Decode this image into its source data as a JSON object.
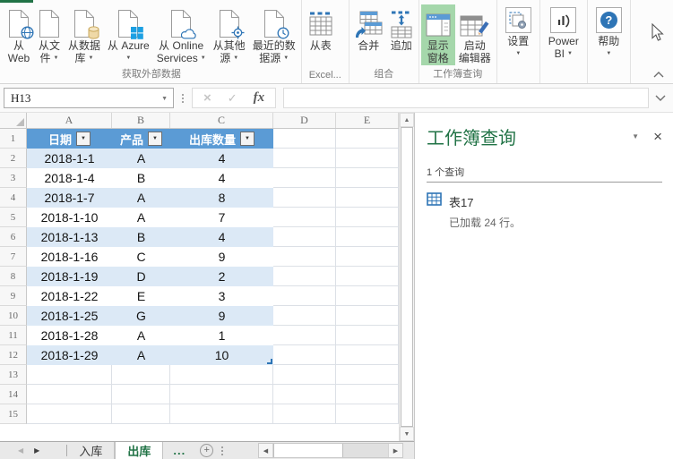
{
  "colors": {
    "excel_green": "#217346",
    "table_header_blue": "#5B9BD5",
    "banded_row_blue": "#DCE9F6",
    "active_button_green": "#A5D7AB"
  },
  "icons": {
    "dropdown_arrow": "▼",
    "filter_arrow": "▼",
    "up_arrow": "▲",
    "down_arrow": "▼",
    "left_arrow": "◀",
    "right_arrow": "▶",
    "close": "×",
    "cancel": "×",
    "check": "✓",
    "plus": "+",
    "help_question": "?"
  },
  "ribbon": {
    "get_external_data": {
      "group_label": "获取外部数据",
      "from_web": {
        "line1": "从",
        "line2": "Web"
      },
      "from_file": {
        "line1": "从文",
        "line2": "件"
      },
      "from_database": {
        "line1": "从数据",
        "line2": "库"
      },
      "from_azure": {
        "line1": "从 Azure"
      },
      "from_online_services": {
        "line1": "从 Online",
        "line2": "Services"
      },
      "from_other_sources": {
        "line1": "从其他",
        "line2": "源"
      },
      "recent_sources": {
        "line1": "最近的数",
        "line2": "据源"
      }
    },
    "excel_group": {
      "group_label": "Excel...",
      "from_table": {
        "line1": "从表"
      }
    },
    "combine_group": {
      "group_label": "组合",
      "merge": {
        "line1": "合并"
      },
      "append": {
        "line1": "追加"
      }
    },
    "queries_group": {
      "group_label": "工作簿查询",
      "show_pane": {
        "line1": "显示",
        "line2": "窗格"
      },
      "launch_editor": {
        "line1": "启动",
        "line2": "编辑器"
      }
    },
    "settings": {
      "line1": "设置"
    },
    "power_bi": {
      "line1": "Power",
      "line2": "BI"
    },
    "help": {
      "line1": "帮助"
    }
  },
  "formula_bar": {
    "name_box": "H13",
    "fx_label": "fx",
    "formula_value": ""
  },
  "grid": {
    "column_headers": [
      "A",
      "B",
      "C",
      "D",
      "E"
    ],
    "row_numbers": [
      "1",
      "2",
      "3",
      "4",
      "5",
      "6",
      "7",
      "8",
      "9",
      "10",
      "11",
      "12",
      "13",
      "14",
      "15"
    ],
    "table": {
      "headers": [
        "日期",
        "产品",
        "出库数量"
      ],
      "rows": [
        [
          "2018-1-1",
          "A",
          "4"
        ],
        [
          "2018-1-4",
          "B",
          "4"
        ],
        [
          "2018-1-7",
          "A",
          "8"
        ],
        [
          "2018-1-10",
          "A",
          "7"
        ],
        [
          "2018-1-13",
          "B",
          "4"
        ],
        [
          "2018-1-16",
          "C",
          "9"
        ],
        [
          "2018-1-19",
          "D",
          "2"
        ],
        [
          "2018-1-22",
          "E",
          "3"
        ],
        [
          "2018-1-25",
          "G",
          "9"
        ],
        [
          "2018-1-28",
          "A",
          "1"
        ],
        [
          "2018-1-29",
          "A",
          "10"
        ]
      ]
    }
  },
  "queries_panel": {
    "title": "工作簿查询",
    "count_label": "1 个查询",
    "query_name": "表17",
    "query_status": "已加载 24 行。"
  },
  "sheet_tabs": {
    "tab_in": "入库",
    "tab_out": "出库",
    "more": "..."
  }
}
